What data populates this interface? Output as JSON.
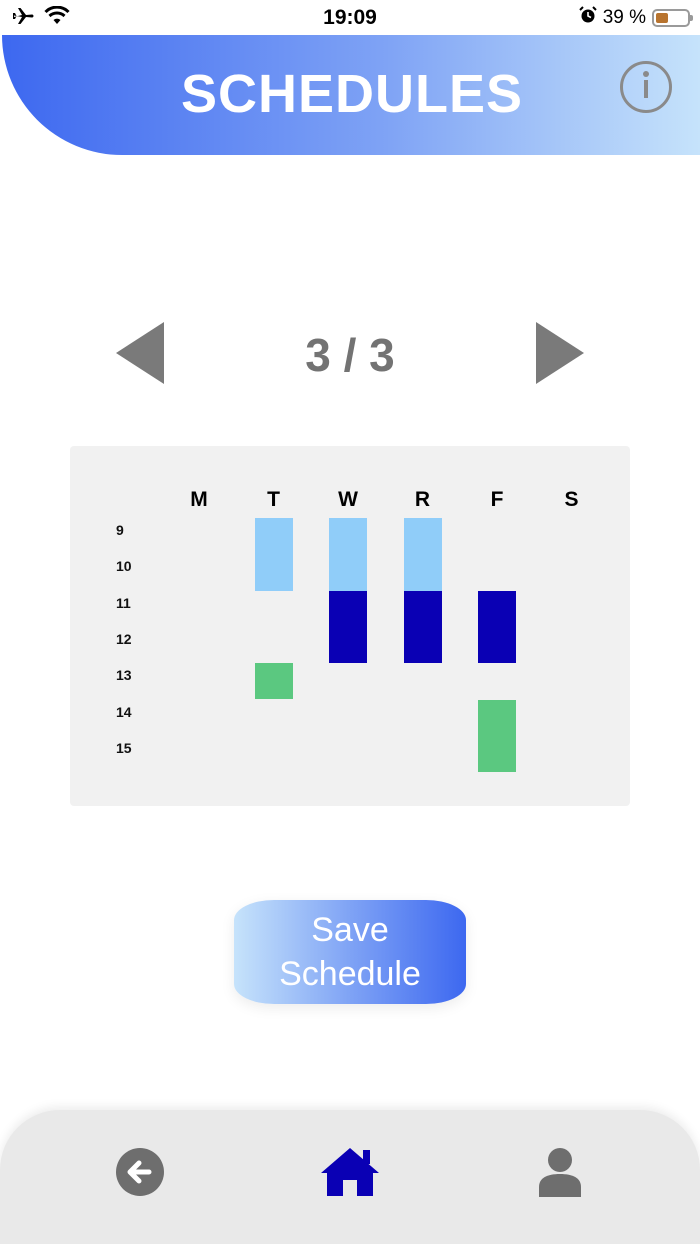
{
  "status_bar": {
    "time": "19:09",
    "battery_text": "39 %",
    "battery_level": 0.39,
    "icons": [
      "airplane-icon",
      "wifi-icon",
      "alarm-icon",
      "battery-icon"
    ]
  },
  "header": {
    "title": "SCHEDULES",
    "info_icon": "info-icon",
    "gradient": [
      "#3d68f0",
      "#c6e3fb"
    ]
  },
  "pager": {
    "indicator": "3 / 3",
    "prev_icon": "triangle-left-icon",
    "next_icon": "triangle-right-icon"
  },
  "schedule": {
    "days": [
      "M",
      "T",
      "W",
      "R",
      "F",
      "S"
    ],
    "hours": [
      "9",
      "10",
      "11",
      "12",
      "13",
      "14",
      "15"
    ],
    "blocks": [
      {
        "day": "T",
        "start": 9,
        "end": 11,
        "color": "#90cdf9"
      },
      {
        "day": "W",
        "start": 9,
        "end": 11,
        "color": "#90cdf9"
      },
      {
        "day": "R",
        "start": 9,
        "end": 11,
        "color": "#90cdf9"
      },
      {
        "day": "W",
        "start": 11,
        "end": 13,
        "color": "#0a00b4"
      },
      {
        "day": "R",
        "start": 11,
        "end": 13,
        "color": "#0a00b4"
      },
      {
        "day": "F",
        "start": 11,
        "end": 13,
        "color": "#0a00b4"
      },
      {
        "day": "T",
        "start": 13,
        "end": 14,
        "color": "#5bc880"
      },
      {
        "day": "F",
        "start": 14,
        "end": 16,
        "color": "#5bc880"
      }
    ]
  },
  "save_button": {
    "line1": "Save",
    "line2": "Schedule"
  },
  "bottom_nav": {
    "items": [
      {
        "name": "back",
        "icon": "arrow-left-circle-icon",
        "color": "#6e6e6e"
      },
      {
        "name": "home",
        "icon": "home-icon",
        "color": "#0a00b4"
      },
      {
        "name": "profile",
        "icon": "user-icon",
        "color": "#6e6e6e"
      }
    ]
  }
}
